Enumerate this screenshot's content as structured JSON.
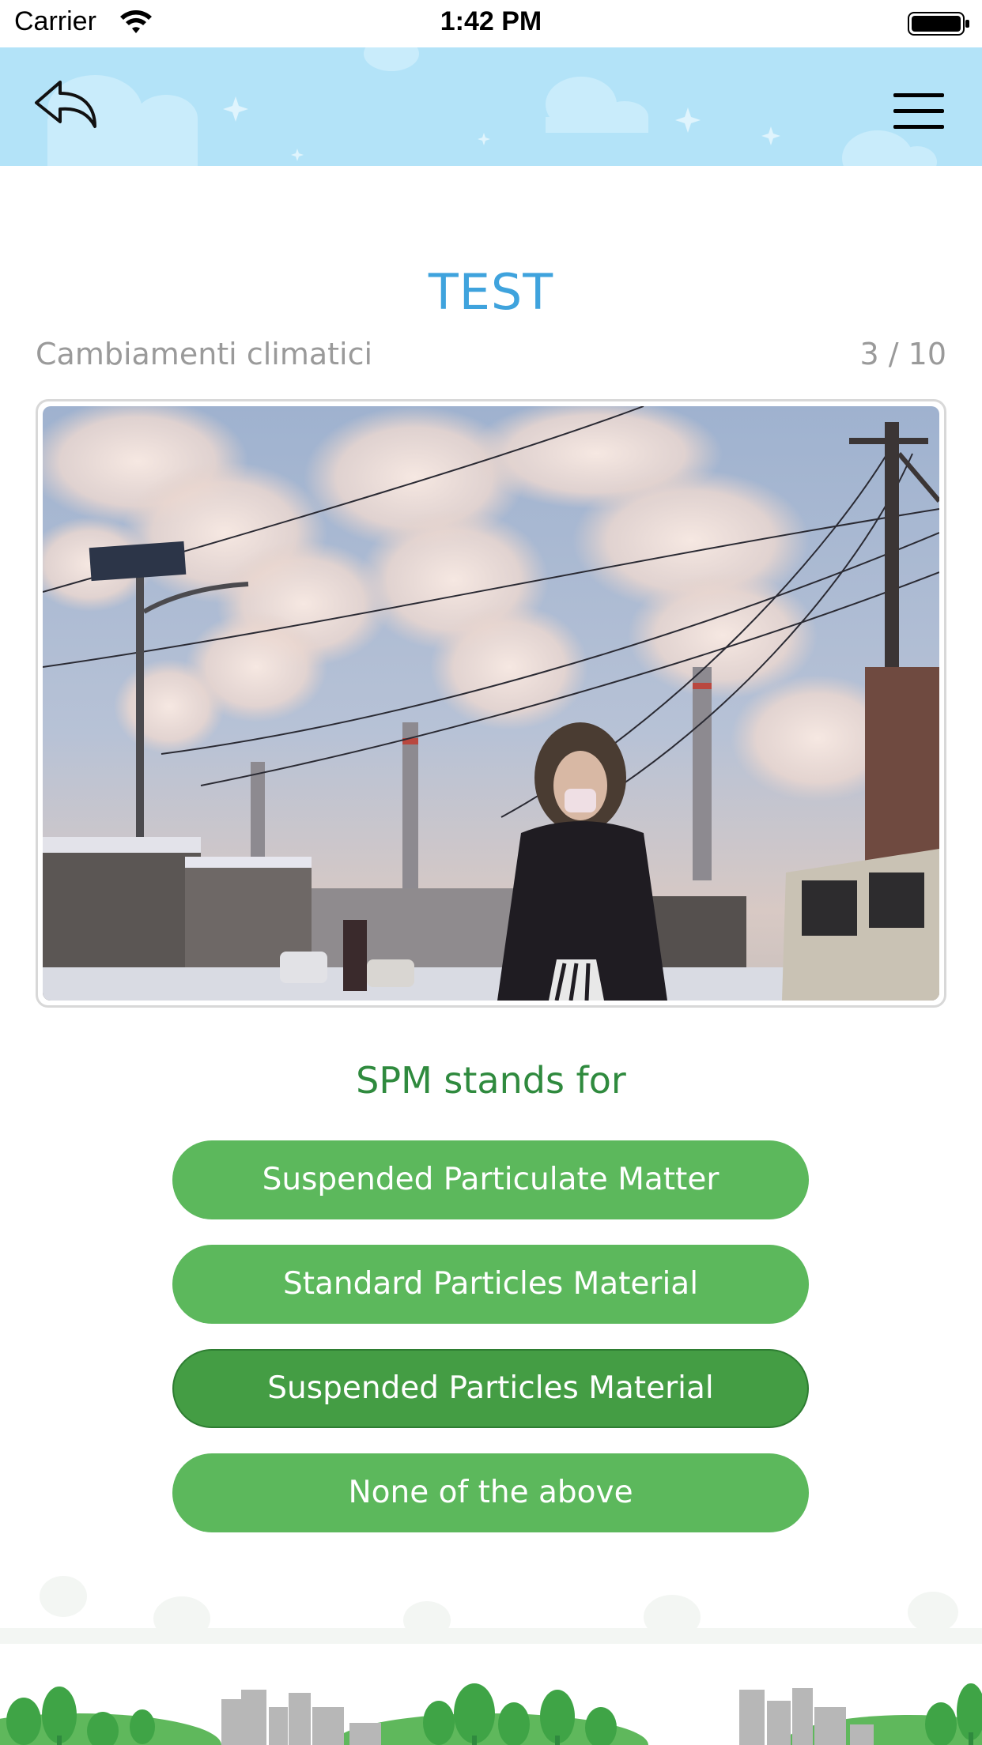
{
  "status_bar": {
    "carrier": "Carrier",
    "time": "1:42 PM",
    "icons": [
      "wifi-icon",
      "battery-icon"
    ]
  },
  "header": {
    "icons": [
      "back-arrow-icon",
      "hamburger-menu-icon"
    ],
    "background_color": "#b3e3f8"
  },
  "quiz": {
    "title": "TEST",
    "category": "Cambiamenti climatici",
    "progress": "3 / 10",
    "question": "SPM stands for",
    "answers": [
      {
        "label": "Suspended Particulate Matter",
        "selected": false
      },
      {
        "label": "Standard Particles Material",
        "selected": false
      },
      {
        "label": "Suspended Particles Material",
        "selected": true
      },
      {
        "label": "None of the above",
        "selected": false
      }
    ]
  },
  "colors": {
    "title": "#3fa3dd",
    "question": "#2f8a3e",
    "answer_button": "#5cb85c",
    "answer_button_selected": "#449d44",
    "muted_text": "#9a9a9a"
  }
}
